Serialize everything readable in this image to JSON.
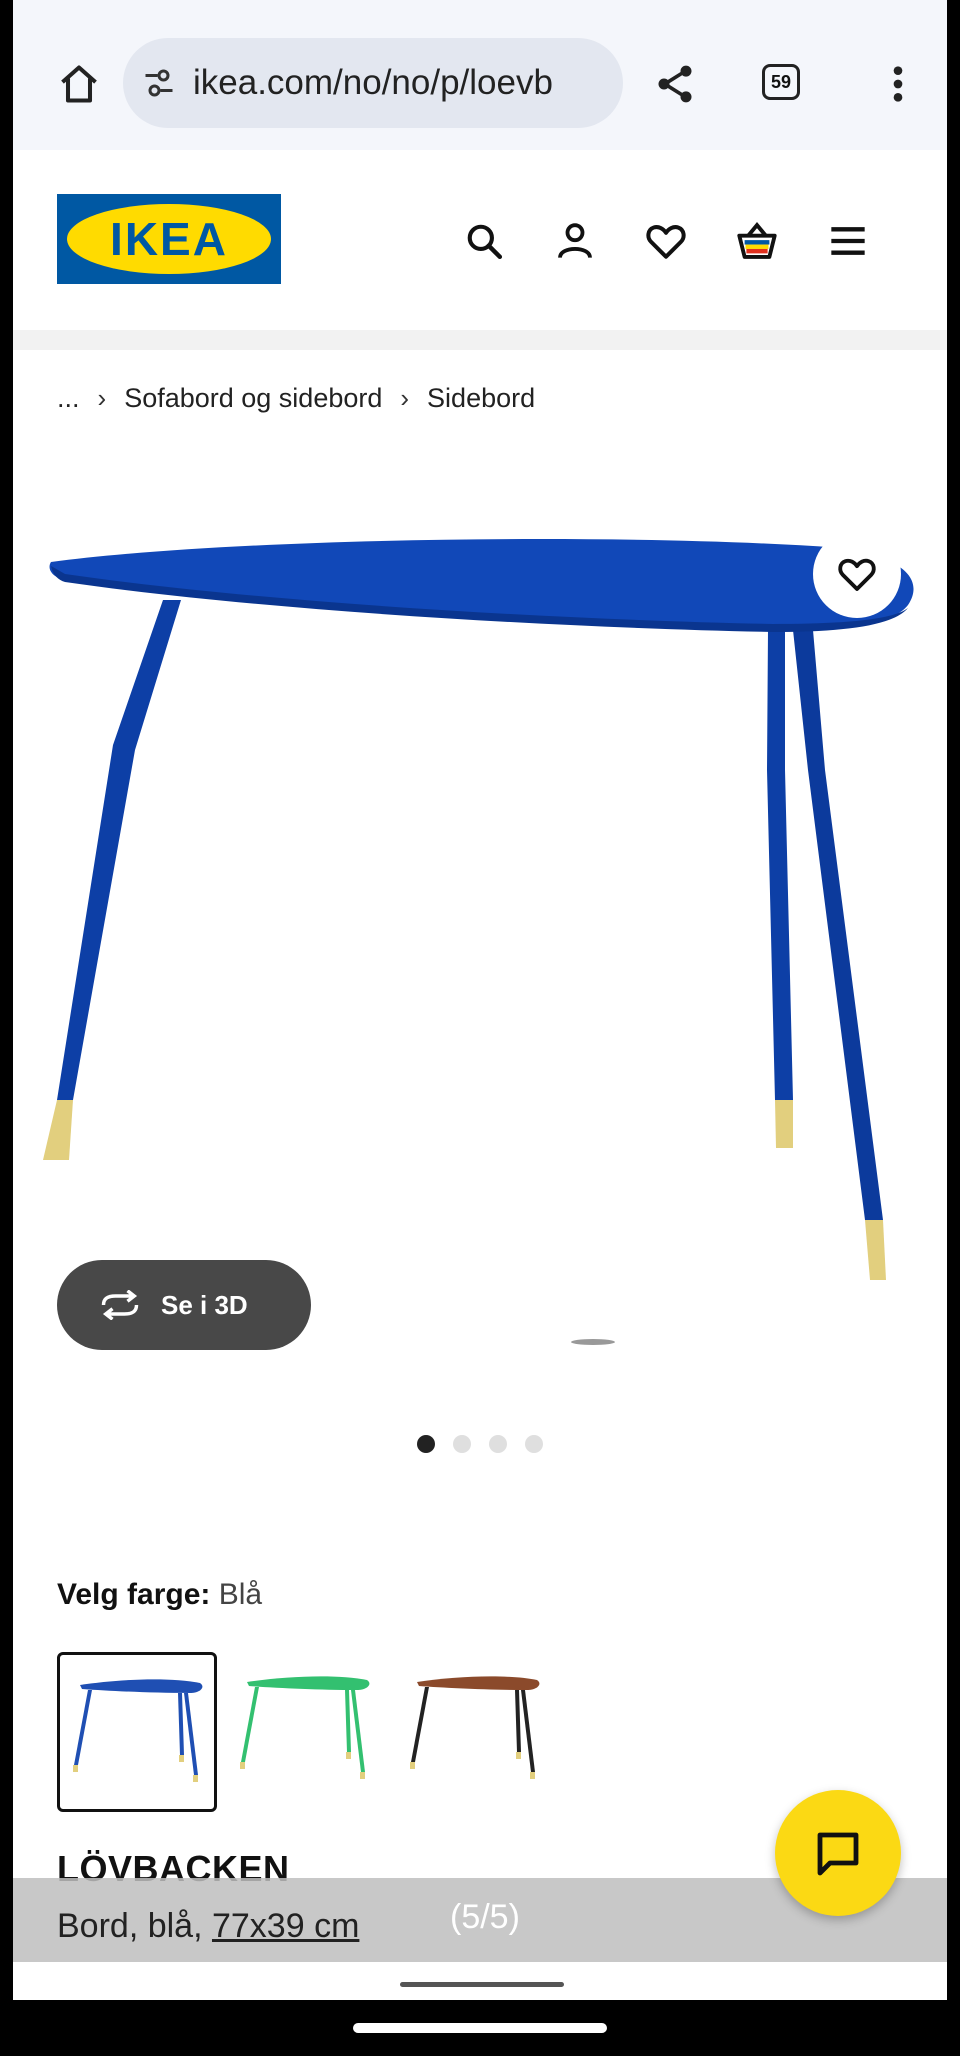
{
  "browser": {
    "url": "ikea.com/no/no/p/loevb",
    "tab_count": "59",
    "icons": [
      "home-icon",
      "tune-icon",
      "share-icon",
      "tabs-icon",
      "more-vert-icon"
    ]
  },
  "site": {
    "logo_text": "IKEA",
    "header_icons": [
      "search-icon",
      "profile-icon",
      "heart-icon",
      "basket-icon",
      "menu-icon"
    ],
    "brand_blue": "#0058a3",
    "brand_yellow": "#ffdb00"
  },
  "breadcrumb": {
    "items": [
      "...",
      "Sofabord og sidebord",
      "Sidebord"
    ],
    "separator": "›"
  },
  "gallery": {
    "view_3d_label": "Se i 3D",
    "dot_count": 4,
    "active_dot": 1
  },
  "color": {
    "label": "Velg farge:",
    "value": "Blå",
    "swatches": [
      {
        "name": "blue",
        "hex": "#1f4fb3",
        "selected": true
      },
      {
        "name": "green",
        "hex": "#33c070",
        "selected": false
      },
      {
        "name": "brown",
        "hex": "#8b4a2b",
        "selected": false
      }
    ]
  },
  "product": {
    "name": "LÖVBACKEN",
    "desc_prefix": "Bord, blå, ",
    "size": "77x39 cm",
    "table_color": "#1148b8"
  },
  "overlay": {
    "counter": "(5/5)"
  }
}
